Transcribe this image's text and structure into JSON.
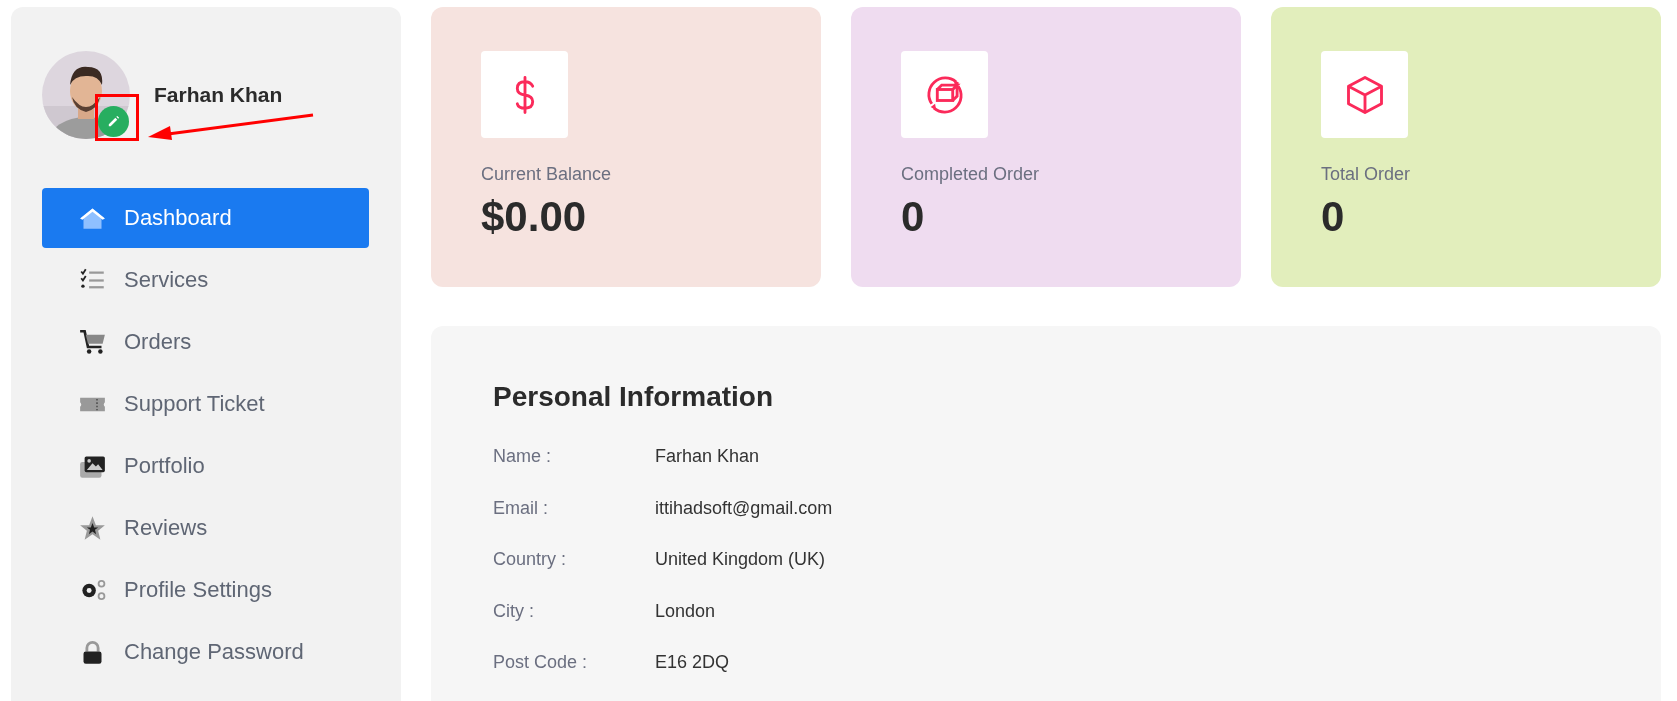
{
  "profile": {
    "name": "Farhan Khan"
  },
  "menu": [
    {
      "label": "Dashboard",
      "kind": "home",
      "selected": true
    },
    {
      "label": "Services",
      "kind": "checklist",
      "selected": false
    },
    {
      "label": "Orders",
      "kind": "cart",
      "selected": false
    },
    {
      "label": "Support Ticket",
      "kind": "ticket",
      "selected": false
    },
    {
      "label": "Portfolio",
      "kind": "images",
      "selected": false
    },
    {
      "label": "Reviews",
      "kind": "star",
      "selected": false
    },
    {
      "label": "Profile Settings",
      "kind": "gears",
      "selected": false
    },
    {
      "label": "Change Password",
      "kind": "lock",
      "selected": false
    }
  ],
  "stats": [
    {
      "label": "Current Balance",
      "value": "$0.00",
      "kind": "dollar",
      "color": "#f6e3df"
    },
    {
      "label": "Completed Order",
      "value": "0",
      "kind": "cycle",
      "color": "#efdcf0"
    },
    {
      "label": "Total Order",
      "value": "0",
      "kind": "box",
      "color": "#e2eebc"
    }
  ],
  "personal_info": {
    "title": "Personal Information",
    "rows": [
      {
        "label": "Name :",
        "value": "Farhan Khan"
      },
      {
        "label": "Email :",
        "value": "ittihadsoft@gmail.com"
      },
      {
        "label": "Country :",
        "value": "United Kingdom (UK)"
      },
      {
        "label": "City :",
        "value": "London"
      },
      {
        "label": "Post Code :",
        "value": "E16 2DQ"
      }
    ]
  }
}
